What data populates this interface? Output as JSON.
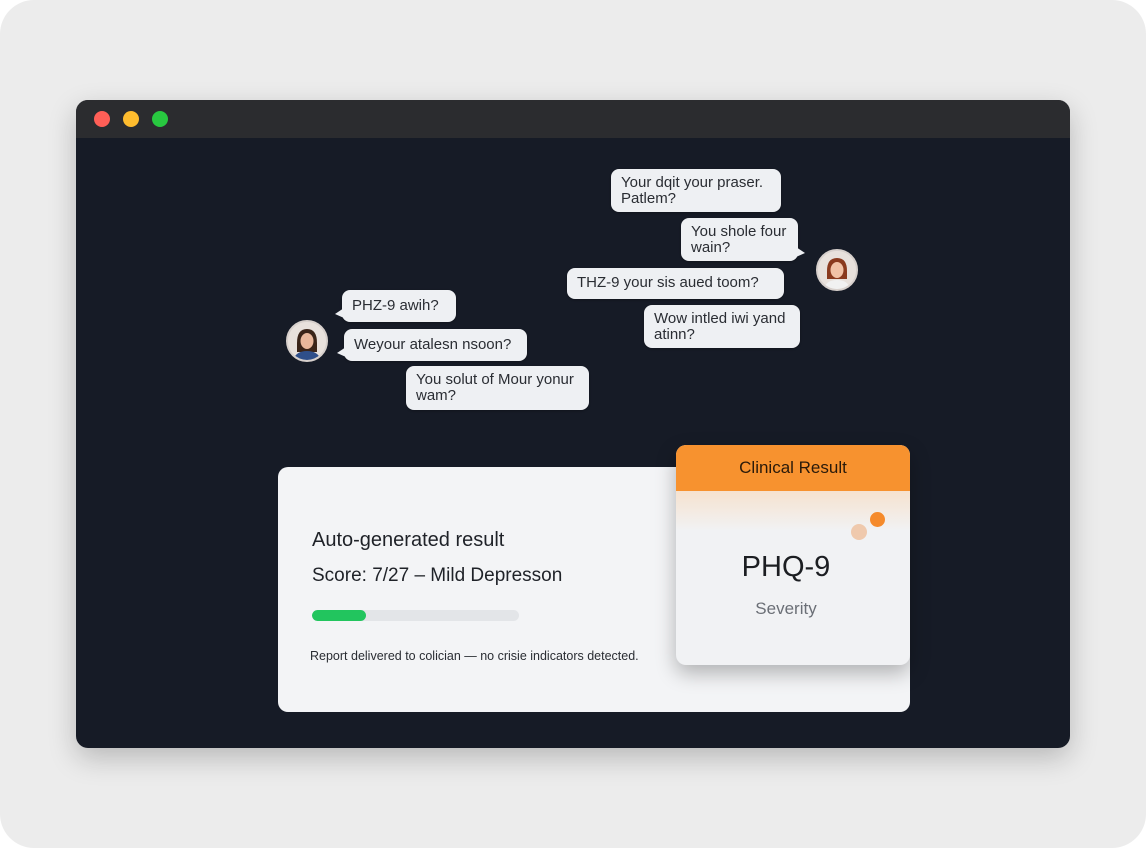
{
  "window": {
    "controls": [
      "close",
      "minimize",
      "zoom"
    ]
  },
  "chat": {
    "messages": [
      {
        "id": "b1",
        "text": "Your dqit your praser.\nPatlem?",
        "side": "right"
      },
      {
        "id": "b2",
        "text": "You shole four\nwain?",
        "side": "right"
      },
      {
        "id": "b3",
        "text": "THZ-9 your sis aued toom?",
        "side": "right"
      },
      {
        "id": "b4",
        "text": "Wow intled iwi yand\natinn?",
        "side": "right"
      },
      {
        "id": "b5",
        "text": "PHZ-9 awih?",
        "side": "left"
      },
      {
        "id": "b6",
        "text": "Weyour atalesn nsoon?",
        "side": "left"
      },
      {
        "id": "b7",
        "text": "You solut of Mour yonur\nwam?",
        "side": "left"
      }
    ],
    "avatars": [
      "patient-avatar",
      "assistant-avatar"
    ]
  },
  "result": {
    "title": "Auto-generated result",
    "score": "Score: 7/27 – Mild Depresson",
    "progress_percent": 26,
    "note": "Report delivered to colician — no crisie indicators detected.",
    "accent": "#22c55e"
  },
  "clinical": {
    "header": "Clinical Result",
    "title": "PHQ-9",
    "subtitle": "Severity",
    "accent": "#f7922f"
  }
}
